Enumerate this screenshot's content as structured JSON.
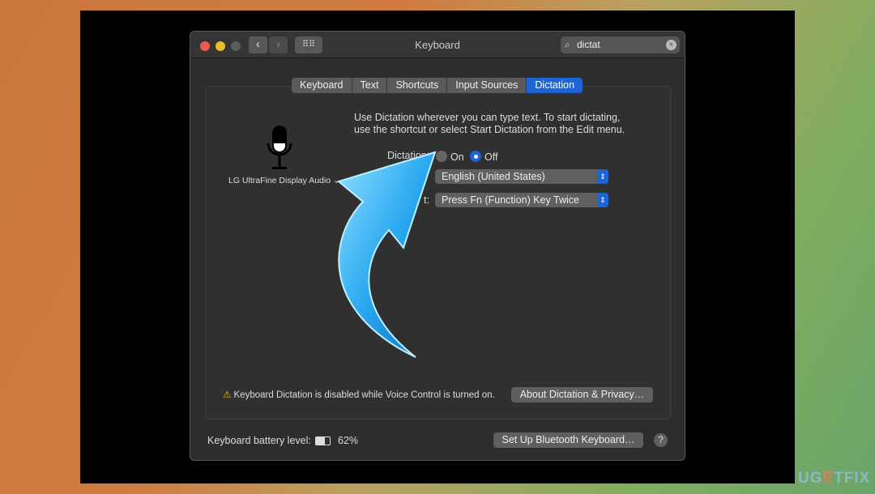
{
  "window": {
    "title": "Keyboard",
    "search_value": "dictat"
  },
  "tabs": [
    {
      "label": "Keyboard"
    },
    {
      "label": "Text"
    },
    {
      "label": "Shortcuts"
    },
    {
      "label": "Input Sources"
    },
    {
      "label": "Dictation",
      "active": true
    }
  ],
  "dictation": {
    "description_line1": "Use Dictation wherever you can type text. To start dictating,",
    "description_line2": "use the shortcut or select Start Dictation from the Edit menu.",
    "mic_source": "LG UltraFine Display Audio",
    "dictation_label": "Dictation:",
    "on_label": "On",
    "off_label": "Off",
    "selected": "Off",
    "language_value": "English (United States)",
    "shortcut_label_partial": "t:",
    "shortcut_value": "Press Fn (Function) Key Twice",
    "warning": "Keyboard Dictation is disabled while Voice Control is turned on.",
    "about_button": "About Dictation & Privacy…"
  },
  "footer": {
    "battery_label": "Keyboard battery level:",
    "battery_percent": "62%",
    "battery_level": 62,
    "bluetooth_button": "Set Up Bluetooth Keyboard…",
    "help": "?"
  },
  "watermark": "UGETFIX",
  "colors": {
    "accent": "#1e64d2",
    "arrow": "#29a8f0"
  }
}
